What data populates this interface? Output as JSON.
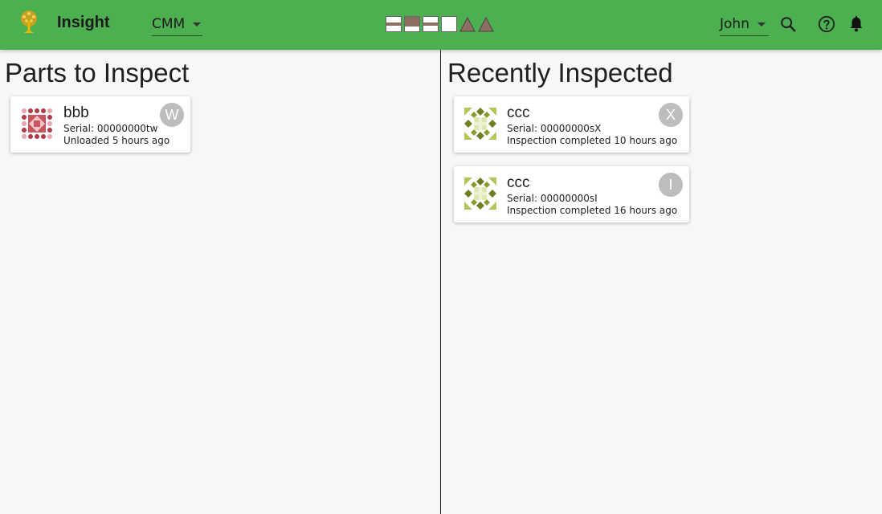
{
  "app": {
    "title": "Insight",
    "station": "CMM",
    "operator": "John"
  },
  "colors": {
    "appbar": "#4caf50",
    "avatar": "#bdbdbd",
    "bbb_thumb": "#c0392b",
    "ccc_thumb": "#8b9a2e"
  },
  "status_icons": [
    "box-banded",
    "box-filled",
    "box-banded",
    "box-plain",
    "triangle",
    "triangle"
  ],
  "toolbar_icons": [
    "search-icon",
    "help-circle-icon",
    "bell-icon"
  ],
  "parts_to_inspect": {
    "heading": "Parts to Inspect",
    "cards": [
      {
        "part": "bbb",
        "serial": "Serial: 00000000tw",
        "status": "Unloaded 5 hours ago",
        "avatar": "W"
      }
    ]
  },
  "recently_inspected": {
    "heading": "Recently Inspected",
    "cards": [
      {
        "part": "ccc",
        "serial": "Serial: 00000000sX",
        "status": "Inspection completed 10 hours ago",
        "avatar": "X"
      },
      {
        "part": "ccc",
        "serial": "Serial: 00000000sI",
        "status": "Inspection completed 16 hours ago",
        "avatar": "I"
      }
    ]
  }
}
